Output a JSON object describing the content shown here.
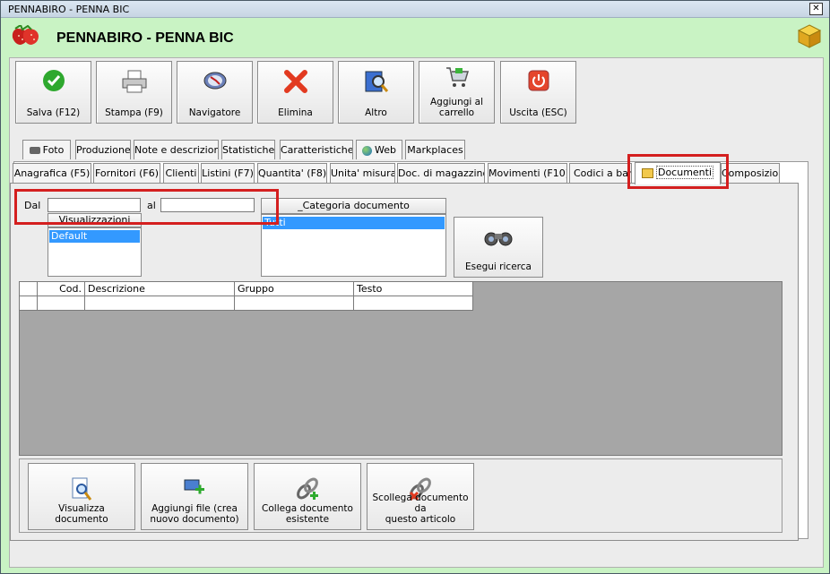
{
  "window": {
    "title": "PENNABIRO - PENNA BIC",
    "close_glyph": "✕"
  },
  "header": {
    "title": "PENNABIRO - PENNA BIC"
  },
  "toolbar": [
    {
      "label": "Salva (F12)",
      "icon": "check-icon"
    },
    {
      "label": "Stampa (F9)",
      "icon": "printer-icon"
    },
    {
      "label": "Navigatore",
      "icon": "compass-icon"
    },
    {
      "label": "Elimina",
      "icon": "delete-x-icon"
    },
    {
      "label": "Altro",
      "icon": "search-book-icon"
    },
    {
      "label_line1": "Aggiungi al",
      "label_line2": "carrello",
      "icon": "cart-icon"
    },
    {
      "label": "Uscita (ESC)",
      "icon": "power-icon"
    }
  ],
  "tabs_row1": [
    "Foto",
    "Produzione",
    "Note e descrizioni",
    "Statistiche",
    "Caratteristiche",
    "Web",
    "Markplaces"
  ],
  "tabs_row2": [
    "Anagrafica (F5)",
    "Fornitori (F6)",
    "Clienti",
    "Listini (F7)",
    "Quantita' (F8)",
    "Unita' misura",
    "Doc. di magazzino",
    "Movimenti (F10)",
    "Codici a barre",
    "Documenti",
    "Composizioni"
  ],
  "filters": {
    "dal_label": "Dal",
    "al_label": "al",
    "dal_value": "",
    "al_value": "",
    "visualizzazioni_header": "Visualizzazioni",
    "visualizzazioni_selected": "Default",
    "categoria_header": "_Categoria documento",
    "categoria_selected": "Tutti",
    "search_button": "Esegui ricerca"
  },
  "grid": {
    "columns": [
      "Cod.",
      "Descrizione",
      "Gruppo",
      "Testo"
    ]
  },
  "actions": [
    {
      "label_line1": "Visualizza documento",
      "label_line2": "",
      "icon": "view-document-icon"
    },
    {
      "label_line1": "Aggiungi file (crea",
      "label_line2": "nuovo documento)",
      "icon": "add-file-icon"
    },
    {
      "label_line1": "Collega documento",
      "label_line2": "esistente",
      "icon": "link-document-icon"
    },
    {
      "label_line1": "Scollega documento da",
      "label_line2": "questo articolo",
      "icon": "unlink-document-icon"
    }
  ],
  "colors": {
    "window_bg": "#c9f3c4",
    "highlight": "#d41f1f",
    "selection": "#3399ff"
  }
}
